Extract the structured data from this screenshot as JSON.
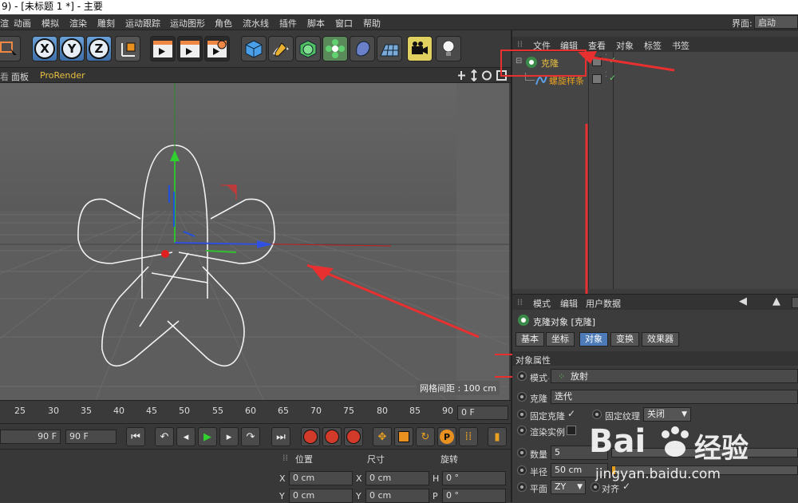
{
  "window": {
    "title": "9) - [未标题 1 *] - 主要"
  },
  "menu": [
    "渲",
    "动画",
    "模拟",
    "渲染",
    "雕刻",
    "运动跟踪",
    "运动图形",
    "角色",
    "流水线",
    "插件",
    "脚本",
    "窗口",
    "帮助"
  ],
  "interface": {
    "label": "界面:",
    "value": "启动"
  },
  "toolbar": {
    "x": "X",
    "y": "Y",
    "z": "Z"
  },
  "viewport_bar": {
    "items": [
      "面板",
      "ProRender"
    ]
  },
  "viewport": {
    "grid_spacing": "网格间距 : 100 cm"
  },
  "timeline": {
    "ticks": [
      "25",
      "30",
      "35",
      "40",
      "45",
      "50",
      "55",
      "60",
      "65",
      "70",
      "75",
      "80",
      "85",
      "90"
    ],
    "frame_field": "0 F"
  },
  "transport": {
    "end_frame": "90 F",
    "max_frame": "90 F"
  },
  "coords": {
    "headers": [
      "位置",
      "尺寸",
      "旋转"
    ],
    "rows": [
      {
        "a": "X",
        "av": "0 cm",
        "b": "X",
        "bv": "0 cm",
        "c": "H",
        "cv": "0 °"
      },
      {
        "a": "Y",
        "av": "0 cm",
        "b": "Y",
        "bv": "0 cm",
        "c": "P",
        "cv": "0 °"
      }
    ]
  },
  "object_manager": {
    "tabs": [
      "文件",
      "编辑",
      "查看",
      "对象",
      "标签",
      "书签"
    ],
    "objects": [
      {
        "name": "克隆",
        "color": "#e8c040"
      },
      {
        "name": "螺旋样条",
        "color": "#e8a020"
      }
    ]
  },
  "attributes": {
    "tabs": [
      "模式",
      "编辑",
      "用户数据"
    ],
    "object_title": "克隆对象 [克隆]",
    "subtabs": [
      "基本",
      "坐标",
      "对象",
      "变换",
      "效果器"
    ],
    "active_subtab": "对象",
    "section": "对象属性",
    "mode_label": "模式",
    "mode_value": "放射",
    "clone_label": "克隆",
    "clone_value": "迭代",
    "fix_clone": "固定克隆",
    "fix_texture": "固定纹理",
    "fix_texture_value": "关闭",
    "render_instances": "渲染实例",
    "count_label": "数量",
    "count_value": "5",
    "radius_label": "半径",
    "radius_value": "50 cm",
    "plane_label": "平面",
    "plane_value": "ZY",
    "align_label": "对齐"
  },
  "watermark": {
    "brand": "Bai",
    "brand2": "经验",
    "url": "jingyan.baidu.com"
  },
  "colors": {
    "accent": "#4c7bb8",
    "annotation": "#e83030",
    "highlight": "#e8c040"
  }
}
